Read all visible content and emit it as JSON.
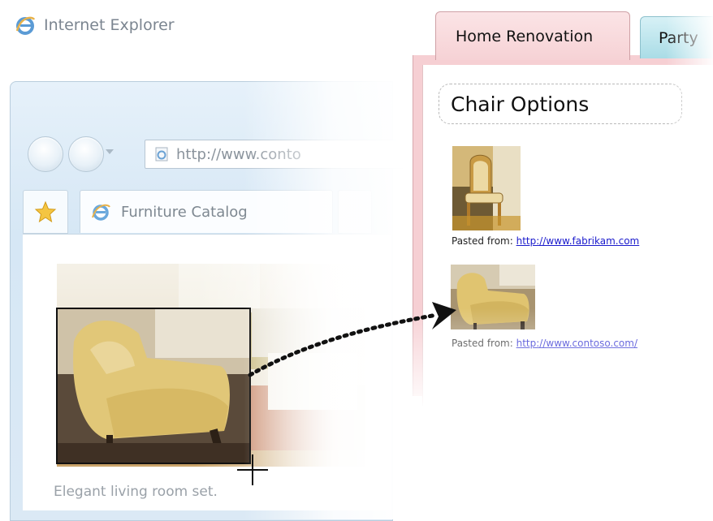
{
  "browser": {
    "title": "Internet Explorer",
    "address_url": "http://www.conto",
    "tab_label": "Furniture Catalog",
    "caption": "Elegant living room set."
  },
  "notebook": {
    "tabs": [
      {
        "label": "Home Renovation"
      },
      {
        "label": "Party"
      }
    ],
    "page_title": "Chair Options",
    "clips": [
      {
        "pasted_label": "Pasted from:",
        "link": "http://www.fabrikam.com"
      },
      {
        "pasted_label": "Pasted from:",
        "link": "http://www.contoso.com/"
      }
    ]
  },
  "colors": {
    "notebook_tab_active": "#f6d2d5",
    "notebook_tab_inactive": "#a9dce6",
    "link": "#1a1acc",
    "ie_frame": "#d6e7f5"
  },
  "icons": [
    "ie-logo-icon",
    "back-button",
    "forward-button",
    "favorites-star-icon",
    "crosshair-cursor-icon",
    "dotted-arrow"
  ]
}
